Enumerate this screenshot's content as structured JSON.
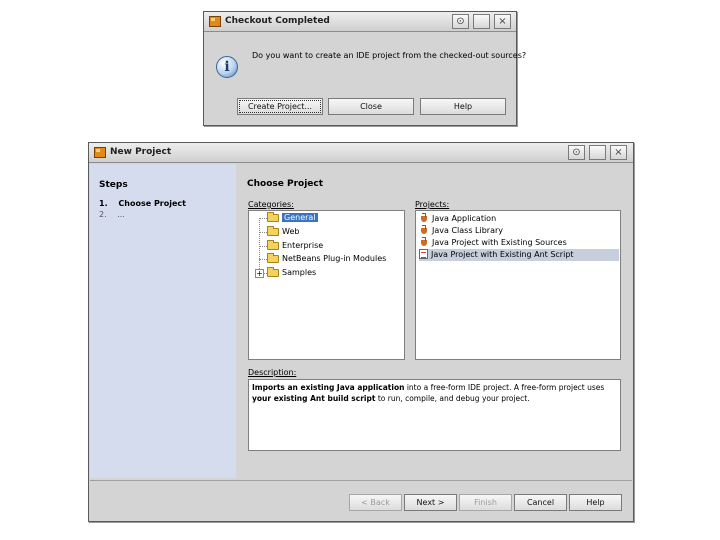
{
  "checkout_dialog": {
    "title": "Checkout Completed",
    "message": "Do you want to create an IDE project from the checked-out sources?",
    "buttons": {
      "create": "Create Project...",
      "close": "Close",
      "help": "Help"
    },
    "info_icon_glyph": "i",
    "title_buttons": {
      "pin": "⊙",
      "maximize": "",
      "close": "×"
    }
  },
  "new_project": {
    "title": "New Project",
    "title_buttons": {
      "pin": "⊙",
      "maximize": "",
      "close": "×"
    },
    "steps": {
      "heading": "Steps",
      "items": [
        {
          "num": "1.",
          "label": "Choose Project"
        },
        {
          "num": "2.",
          "label": "..."
        }
      ]
    },
    "panel_heading": "Choose Project",
    "categories": {
      "label": "Categories:",
      "items": [
        "General",
        "Web",
        "Enterprise",
        "NetBeans Plug-in Modules",
        "Samples"
      ],
      "selected": "General",
      "expander": "+"
    },
    "projects": {
      "label": "Projects:",
      "items": [
        "Java Application",
        "Java Class Library",
        "Java Project with Existing Sources",
        "Java Project with Existing Ant Script"
      ],
      "selected": "Java Project with Existing Ant Script"
    },
    "description": {
      "label": "Description:",
      "line1_bold": "Imports an existing Java application",
      "line1_rest": " into a free-form IDE project. A free-form project uses",
      "line2_bold": "your existing Ant build script",
      "line2_rest": " to run, compile, and debug your project."
    },
    "buttons": {
      "back": "< Back",
      "next": "Next >",
      "finish": "Finish",
      "cancel": "Cancel",
      "help": "Help"
    }
  }
}
